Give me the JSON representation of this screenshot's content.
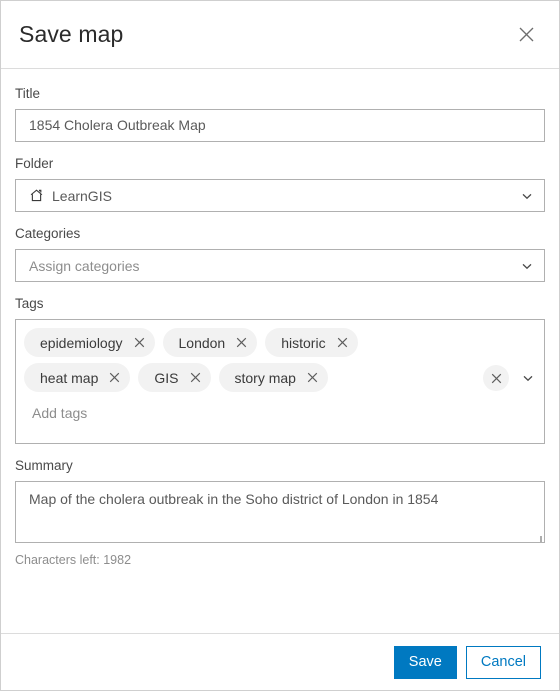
{
  "dialog": {
    "title": "Save map",
    "close_icon": "close-icon"
  },
  "form": {
    "title_field": {
      "label": "Title",
      "value": "1854 Cholera Outbreak Map"
    },
    "folder_field": {
      "label": "Folder",
      "value": "LearnGIS",
      "icon": "home-icon",
      "chevron": "chevron-down-icon"
    },
    "categories_field": {
      "label": "Categories",
      "placeholder": "Assign categories",
      "value": "",
      "chevron": "chevron-down-icon"
    },
    "tags_field": {
      "label": "Tags",
      "placeholder": "Add tags",
      "tags": [
        "epidemiology",
        "London",
        "historic",
        "heat map",
        "GIS",
        "story map"
      ],
      "rows": [
        [
          "epidemiology",
          "London",
          "historic"
        ],
        [
          "heat map",
          "GIS",
          "story map"
        ]
      ],
      "clear_icon": "close-circle-icon",
      "chevron": "chevron-down-icon"
    },
    "summary_field": {
      "label": "Summary",
      "value": "Map of the cholera outbreak in the Soho district of London in 1854",
      "characters_left": "Characters left: 1982"
    }
  },
  "footer": {
    "save_label": "Save",
    "cancel_label": "Cancel"
  },
  "colors": {
    "accent": "#0079c1",
    "border": "#b0b0b0",
    "chip_bg": "#f2f2f2",
    "placeholder": "#8d8d8d"
  }
}
